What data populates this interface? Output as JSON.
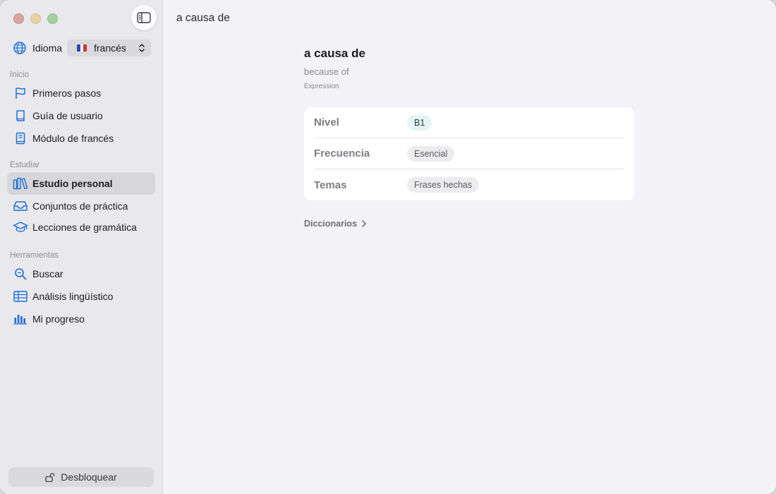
{
  "window": {
    "title": "a causa de"
  },
  "sidebar": {
    "language": {
      "label": "Idioma",
      "value": "francés",
      "flag_colors": [
        "#2c4aa8",
        "#ffffff",
        "#d8323b"
      ]
    },
    "sections": [
      {
        "title": "Inicio",
        "items": [
          {
            "label": "Primeros pasos",
            "icon": "flag-icon"
          },
          {
            "label": "Guía de usuario",
            "icon": "book-icon"
          },
          {
            "label": "Módulo de francés",
            "icon": "notebook-icon"
          }
        ]
      },
      {
        "title": "Estudiar",
        "items": [
          {
            "label": "Estudio personal",
            "icon": "books-icon",
            "active": true
          },
          {
            "label": "Conjuntos de práctica",
            "icon": "tray-icon"
          },
          {
            "label": "Lecciones de gramática",
            "icon": "graduation-cap-icon"
          }
        ]
      },
      {
        "title": "Herramientas",
        "items": [
          {
            "label": "Buscar",
            "icon": "search-icon"
          },
          {
            "label": "Análisis lingüístico",
            "icon": "table-icon"
          },
          {
            "label": "Mi progreso",
            "icon": "bar-chart-icon"
          }
        ]
      }
    ],
    "unlock_label": "Desbloquear"
  },
  "entry": {
    "term": "a causa de",
    "translation": "because of",
    "part_of_speech": "Expression",
    "rows": [
      {
        "key": "Nivel",
        "value": "B1"
      },
      {
        "key": "Frecuencia",
        "value": "Esencial"
      },
      {
        "key": "Temas",
        "value": "Frases hechas"
      }
    ],
    "dictionaries_label": "Diccionarios"
  },
  "colors": {
    "accent": "#1d6fd8",
    "sidebar_bg": "#e8e8ed",
    "content_bg": "#f2f2f7"
  }
}
